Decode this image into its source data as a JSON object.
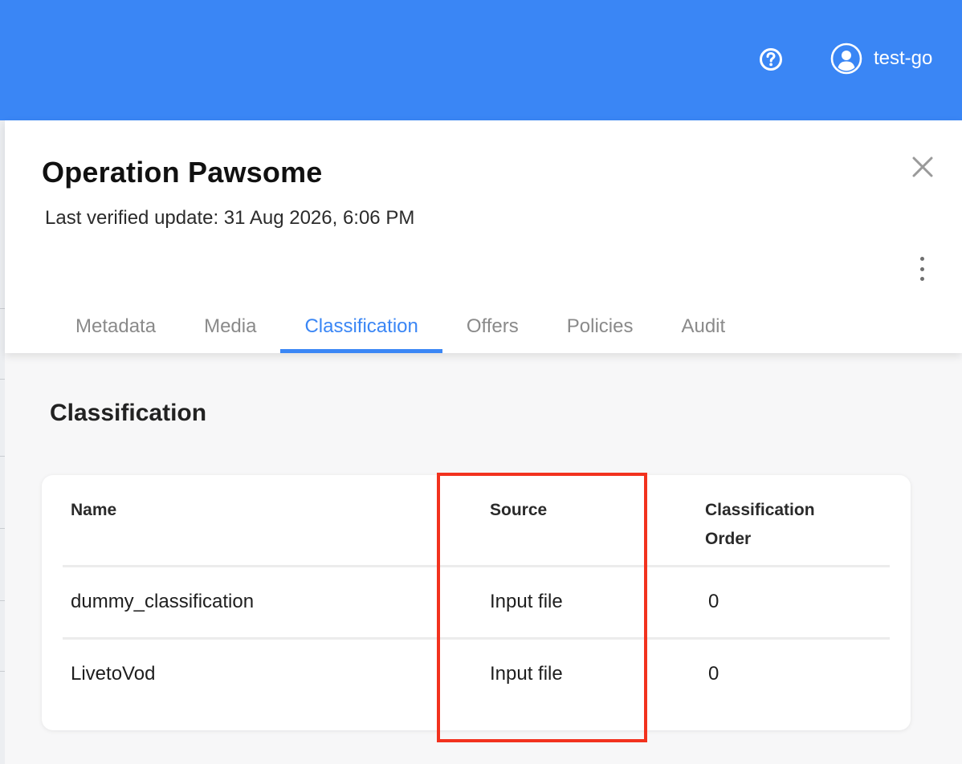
{
  "header": {
    "help_icon": "help-circle-icon",
    "user_icon": "user-avatar-icon",
    "username": "test-go",
    "bar_color": "#3a86f5"
  },
  "detail": {
    "title": "Operation Pawsome",
    "last_update": "Last verified update: 31 Aug 2026, 6:06 PM",
    "close_icon": "close-icon",
    "more_icon": "more-vertical-icon"
  },
  "tabs": [
    {
      "label": "Metadata",
      "active": false
    },
    {
      "label": "Media",
      "active": false
    },
    {
      "label": "Classification",
      "active": true
    },
    {
      "label": "Offers",
      "active": false
    },
    {
      "label": "Policies",
      "active": false
    },
    {
      "label": "Audit",
      "active": false
    }
  ],
  "classification": {
    "section_title": "Classification",
    "columns": {
      "name": "Name",
      "source": "Source",
      "order_line1": "Classification",
      "order_line2": "Order"
    },
    "rows": [
      {
        "name": "dummy_classification",
        "source": "Input file",
        "order": "0"
      },
      {
        "name": "LivetoVod",
        "source": "Input file",
        "order": "0"
      }
    ]
  },
  "annotation": {
    "highlight_color": "#f2321e",
    "highlighted_column": "Source"
  }
}
